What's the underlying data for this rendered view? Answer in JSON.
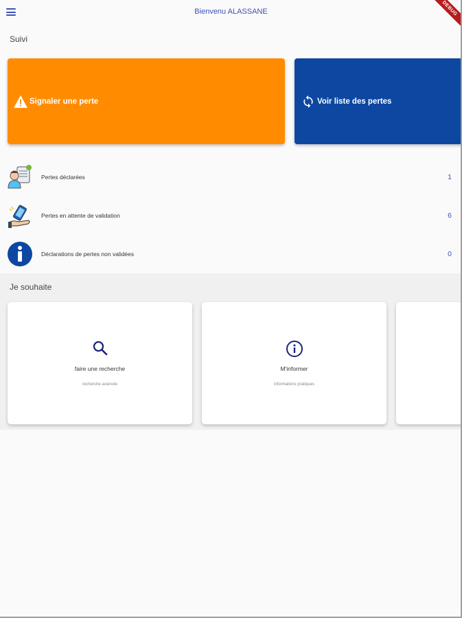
{
  "appbar": {
    "title": "Bienvenu ALASSANE",
    "menu_icon": "menu-icon",
    "debug_banner": "DEBUG"
  },
  "suivi": {
    "title": "Suivi",
    "actions": [
      {
        "label": "Signaler une perte",
        "icon": "warning-icon",
        "color": "#ff8c00"
      },
      {
        "label": "Voir liste des pertes",
        "icon": "refresh-icon",
        "color": "#0d47a1"
      }
    ],
    "stats": [
      {
        "label": "Pertes déclarées",
        "count": "1",
        "icon": "person-document-icon"
      },
      {
        "label": "Pertes en attente de validation",
        "count": "6",
        "icon": "hand-phone-icon"
      },
      {
        "label": "Déclarations de pertes  non validées",
        "count": "0",
        "icon": "info-icon"
      }
    ]
  },
  "souhaite": {
    "title": "Je souhaite",
    "cards": [
      {
        "title": "faire une recherche",
        "subtitle": "recherche avancée",
        "icon": "search-icon"
      },
      {
        "title": "M'informer",
        "subtitle": "informations pratiques",
        "icon": "info-outline-icon"
      },
      {
        "title": "",
        "subtitle": "",
        "icon": ""
      }
    ]
  },
  "colors": {
    "accent": "#3f51b5",
    "orange": "#ff8c00",
    "blue": "#0d47a1"
  }
}
